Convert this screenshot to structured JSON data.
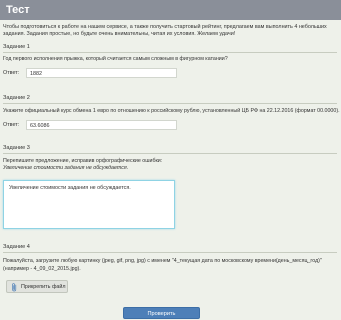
{
  "window": {
    "title": "Тест"
  },
  "intro": "Чтобы подготовиться к работе на нашем сервисе, а также получить стартовый рейтинг, предлагаем вам выполнить 4 небольших задания. Задания простые, но будьте очень внимательны, читая их условия. Желаем удачи!",
  "tasks": [
    {
      "title": "Задание 1",
      "text": "Год первого исполнения прыжка, который считается самым сложным в фигурном катании?",
      "answer_label": "Ответ:",
      "answer_value": "1882"
    },
    {
      "title": "Задание 2",
      "text": "Укажите официальный курс обмена 1 евро по отношению к российскому рублю, установленный ЦБ РФ на 22.12.2016 (формат 00.0000).",
      "answer_label": "Ответ:",
      "answer_value": "63.6086"
    },
    {
      "title": "Задание 3",
      "text": "Перепишите предложение, исправив орфографические ошибки:",
      "sentence": "Увеличение стоимости задания не обсуждается.",
      "textarea_value": "Увеличение стоимости задания не обсуждается."
    },
    {
      "title": "Задание 4",
      "text_line1": "Пожалуйста, загрузите любую картинку (jpeg, gif, png, jpg) с именем \"4_текущая дата по московскому времени(день_месяц_год)\"",
      "text_line2": "(например - 4_09_02_2015.jpg).",
      "attach_label": "Прикрепить файл",
      "attach_icon": "paperclip-icon"
    }
  ],
  "submit_label": "Проверить"
}
